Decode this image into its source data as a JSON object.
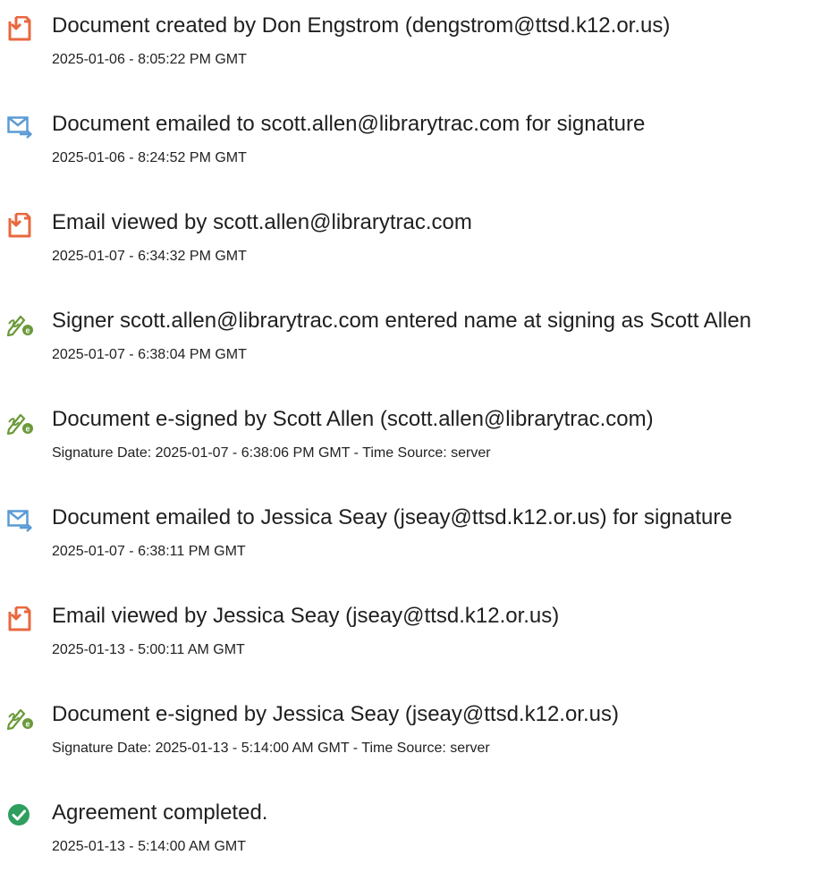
{
  "colors": {
    "doc_icon": "#e8683f",
    "email_icon": "#5b9bd5",
    "sign_icon": "#6b9a3a",
    "complete_icon": "#2e9f5e"
  },
  "events": [
    {
      "icon": "document-icon",
      "title": "Document created by Don Engstrom (dengstrom@ttsd.k12.or.us)",
      "meta": "2025-01-06 - 8:05:22 PM GMT"
    },
    {
      "icon": "email-icon",
      "title": "Document emailed to scott.allen@librarytrac.com for signature",
      "meta": "2025-01-06 - 8:24:52 PM GMT"
    },
    {
      "icon": "document-icon",
      "title": "Email viewed by scott.allen@librarytrac.com",
      "meta": "2025-01-07 - 6:34:32 PM GMT"
    },
    {
      "icon": "esign-icon",
      "title": "Signer scott.allen@librarytrac.com entered name at signing as Scott Allen",
      "meta": "2025-01-07 - 6:38:04 PM GMT"
    },
    {
      "icon": "esign-icon",
      "title": "Document e-signed by Scott Allen (scott.allen@librarytrac.com)",
      "meta": "Signature Date: 2025-01-07 - 6:38:06 PM GMT - Time Source: server"
    },
    {
      "icon": "email-icon",
      "title": "Document emailed to Jessica Seay (jseay@ttsd.k12.or.us) for signature",
      "meta": "2025-01-07 - 6:38:11 PM GMT"
    },
    {
      "icon": "document-icon",
      "title": "Email viewed by Jessica Seay (jseay@ttsd.k12.or.us)",
      "meta": "2025-01-13 - 5:00:11 AM GMT"
    },
    {
      "icon": "esign-icon",
      "title": "Document e-signed by Jessica Seay (jseay@ttsd.k12.or.us)",
      "meta": "Signature Date: 2025-01-13 - 5:14:00 AM GMT - Time Source: server"
    },
    {
      "icon": "check-circle-icon",
      "title": "Agreement completed.",
      "meta": "2025-01-13 - 5:14:00 AM GMT"
    }
  ]
}
